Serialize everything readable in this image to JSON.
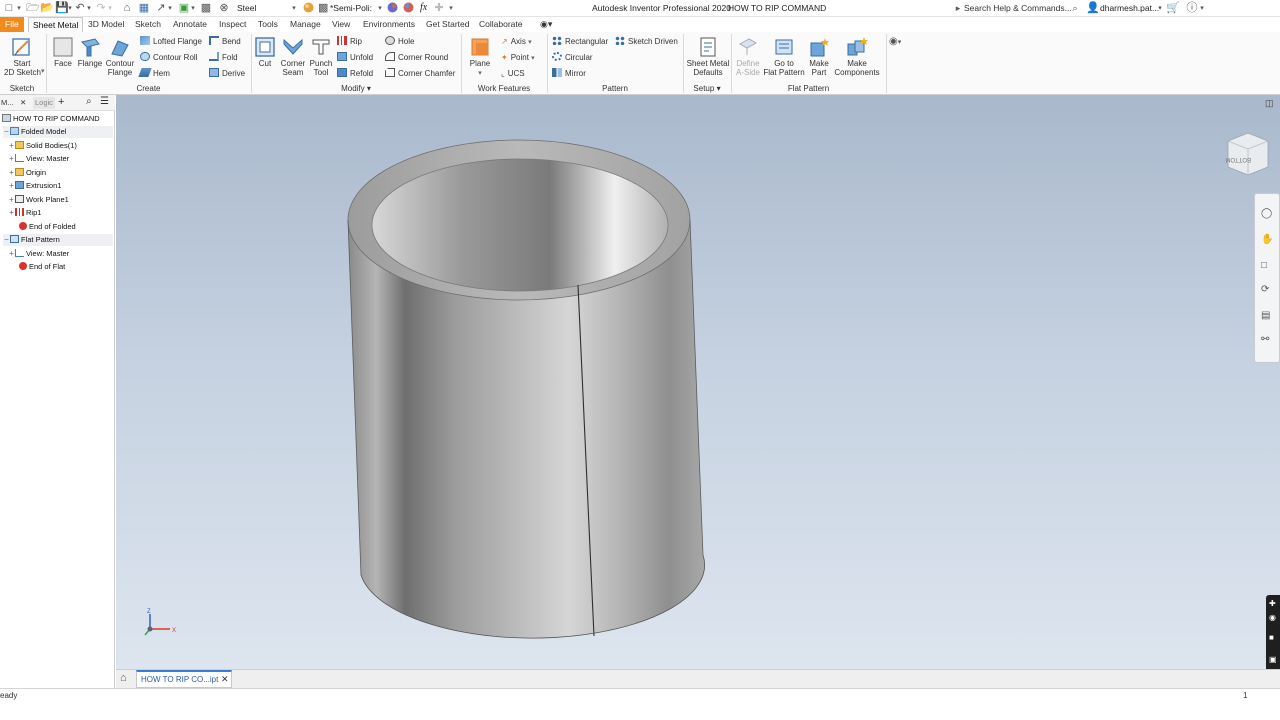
{
  "qat": {
    "material": "Steel",
    "appearance": "*Semi-Poli:",
    "fx": "fx",
    "window_title": "Autodesk Inventor Professional 2020",
    "document_title": "HOW TO RIP COMMAND",
    "search_placeholder": "Search Help & Commands...",
    "user": "dharmesh.pat..."
  },
  "tabs": [
    "File",
    "Sheet Metal",
    "3D Model",
    "Sketch",
    "Annotate",
    "Inspect",
    "Tools",
    "Manage",
    "View",
    "Environments",
    "Get Started",
    "Collaborate"
  ],
  "ribbon": {
    "sketch": {
      "start": "Start",
      "sketch2d": "2D Sketch",
      "group": "Sketch"
    },
    "create": {
      "face": "Face",
      "flange": "Flange",
      "contour": "Contour",
      "flange2": "Flange",
      "lofted_flange": "Lofted Flange",
      "contour_roll": "Contour Roll",
      "hem": "Hem",
      "bend": "Bend",
      "fold": "Fold",
      "derive": "Derive",
      "group": "Create"
    },
    "modify": {
      "cut": "Cut",
      "corner": "Corner",
      "seam": "Seam",
      "punch": "Punch",
      "tool": "Tool",
      "rip": "Rip",
      "unfold": "Unfold",
      "refold": "Refold",
      "hole": "Hole",
      "corner_round": "Corner Round",
      "corner_chamfer": "Corner Chamfer",
      "group": "Modify"
    },
    "work": {
      "plane": "Plane",
      "axis": "Axis",
      "point": "Point",
      "ucs": "UCS",
      "group": "Work Features"
    },
    "pattern": {
      "rectangular": "Rectangular",
      "sketch_driven": "Sketch Driven",
      "circular": "Circular",
      "mirror": "Mirror",
      "group": "Pattern"
    },
    "setup": {
      "sheet_metal": "Sheet Metal",
      "defaults": "Defaults",
      "group": "Setup"
    },
    "flat": {
      "define": "Define",
      "a_side": "A-Side",
      "goto": "Go to",
      "flat_pattern": "Flat Pattern",
      "make": "Make",
      "part": "Part",
      "make2": "Make",
      "components": "Components",
      "group": "Flat Pattern"
    }
  },
  "browser": {
    "tab_model": "M...",
    "tab_logic": "Logic",
    "items": [
      "HOW TO RIP COMMAND",
      "Folded Model",
      "Solid Bodies(1)",
      "View: Master",
      "Origin",
      "Extrusion1",
      "Work Plane1",
      "Rip1",
      "End of Folded",
      "Flat Pattern",
      "View: Master",
      "End of Flat"
    ]
  },
  "viewport": {
    "viewcube_label": "BOTTOM",
    "triad": {
      "z": "Z",
      "x": "X"
    }
  },
  "doc_tab": "HOW TO RIP CO...ipt",
  "status": {
    "text": "eady",
    "count": "1"
  },
  "colors": {
    "file_tab": "#f28b1d",
    "viewport_top": "#a9b8cc",
    "viewport_bottom": "#dde5ef",
    "error": "#d9342b"
  }
}
